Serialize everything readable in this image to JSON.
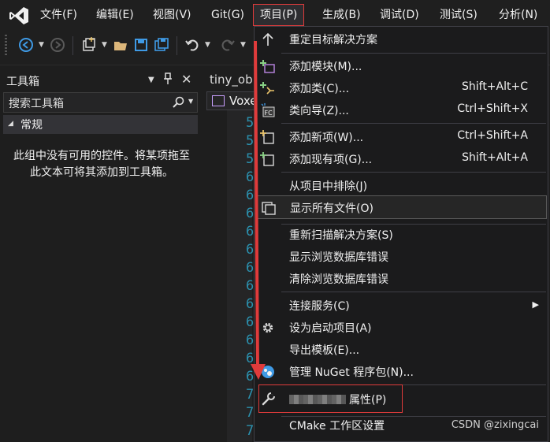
{
  "menubar": {
    "items": [
      {
        "label": "文件(F)"
      },
      {
        "label": "编辑(E)"
      },
      {
        "label": "视图(V)"
      },
      {
        "label": "Git(G)"
      },
      {
        "label": "项目(P)"
      },
      {
        "label": "生成(B)"
      },
      {
        "label": "调试(D)"
      },
      {
        "label": "测试(S)"
      },
      {
        "label": "分析(N)"
      }
    ]
  },
  "toolbox": {
    "title": "工具箱",
    "search_label": "搜索工具箱",
    "group": "常规",
    "empty_message": "此组中没有可用的控件。将某项拖至此文本可将其添加到工具箱。"
  },
  "editor": {
    "tab_label": "tiny_ob",
    "nav_label": "Voxe",
    "line_numbers": [
      "5",
      "5",
      "5",
      "6",
      "6",
      "6",
      "6",
      "6",
      "6",
      "6",
      "6",
      "6",
      "6",
      "6",
      "6",
      "7",
      "7",
      "7"
    ]
  },
  "project_menu": {
    "items": {
      "retarget": "重定目标解决方案",
      "add_module": "添加模块(M)...",
      "add_class": "添加类(C)...",
      "add_class_shortcut": "Shift+Alt+C",
      "class_wizard": "类向导(Z)...",
      "class_wizard_shortcut": "Ctrl+Shift+X",
      "add_new_item": "添加新项(W)...",
      "add_new_item_shortcut": "Ctrl+Shift+A",
      "add_existing_item": "添加现有项(G)...",
      "add_existing_item_shortcut": "Shift+Alt+A",
      "exclude": "从项目中排除(J)",
      "show_all_files": "显示所有文件(O)",
      "rescan": "重新扫描解决方案(S)",
      "show_browse_errors": "显示浏览数据库错误",
      "clear_browse_errors": "清除浏览数据库错误",
      "connected_services": "连接服务(C)",
      "set_startup": "设为启动项目(A)",
      "export_template": "导出模板(E)...",
      "manage_nuget": "管理 NuGet 程序包(N)...",
      "properties": "属性(P)",
      "cmake_settings": "CMake 工作区设置"
    }
  },
  "watermark": "CSDN @zixingcai",
  "colors": {
    "accent_red": "#e03b3b",
    "menu_bg": "#1b1b1c",
    "line_number": "#2b91af"
  }
}
